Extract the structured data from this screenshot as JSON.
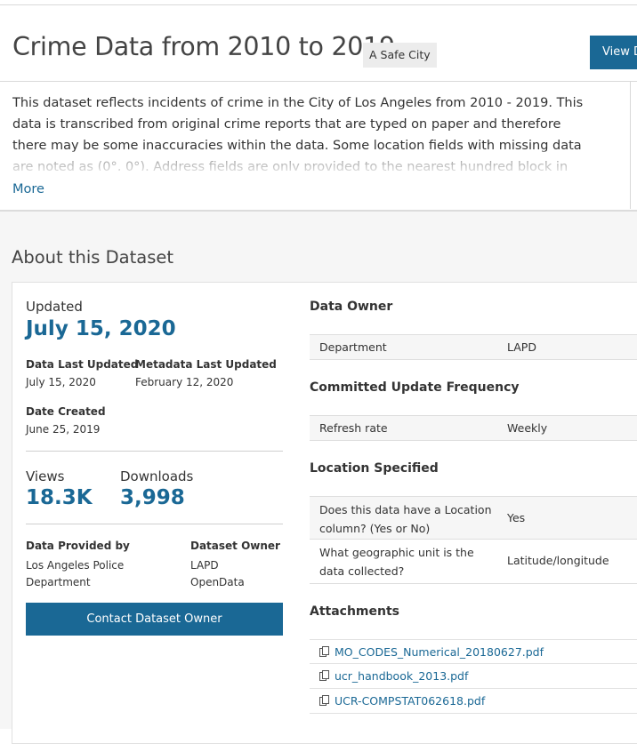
{
  "header": {
    "title": "Crime Data from 2010 to 2019",
    "tag": "A Safe City",
    "view_button": "View Data"
  },
  "description": {
    "text": "This dataset reflects incidents of crime in the City of Los Angeles from 2010 - 2019. This data is transcribed from original crime reports that are typed on paper and therefore there may be some inaccuracies within the data. Some location fields with missing data are noted as (0°, 0°). Address fields are only provided to the nearest hundred block in order to",
    "more_link": "More"
  },
  "about": {
    "heading": "About this Dataset",
    "updated_label": "Updated",
    "updated_value": "July 15, 2020",
    "data_last_updated_label": "Data Last Updated",
    "data_last_updated_value": "July 15, 2020",
    "metadata_last_updated_label": "Metadata Last Updated",
    "metadata_last_updated_value": "February 12, 2020",
    "date_created_label": "Date Created",
    "date_created_value": "June 25, 2019",
    "views_label": "Views",
    "views_value": "18.3K",
    "downloads_label": "Downloads",
    "downloads_value": "3,998",
    "provided_by_label": "Data Provided by",
    "provided_by_value": "Los Angeles Police Department",
    "dataset_owner_label": "Dataset Owner",
    "dataset_owner_value": "LAPD OpenData",
    "contact_button": "Contact Dataset Owner"
  },
  "details": {
    "data_owner": {
      "heading": "Data Owner",
      "rows": [
        {
          "key": "Department",
          "value": "LAPD"
        }
      ]
    },
    "update_frequency": {
      "heading": "Committed Update Frequency",
      "rows": [
        {
          "key": "Refresh rate",
          "value": "Weekly"
        }
      ]
    },
    "location": {
      "heading": "Location Specified",
      "rows": [
        {
          "key": "Does this data have a Location column? (Yes or No)",
          "value": "Yes"
        },
        {
          "key": "What geographic unit is the data collected?",
          "value": "Latitude/longitude"
        }
      ]
    },
    "attachments": {
      "heading": "Attachments",
      "files": [
        "MO_CODES_Numerical_20180627.pdf",
        "ucr_handbook_2013.pdf",
        "UCR-COMPSTAT062618.pdf"
      ]
    }
  },
  "colors": {
    "accent": "#1a6895",
    "tag_bg": "#ececec",
    "page_grey": "#f6f6f6"
  },
  "icons": {
    "attachment": "document-copy-icon"
  }
}
